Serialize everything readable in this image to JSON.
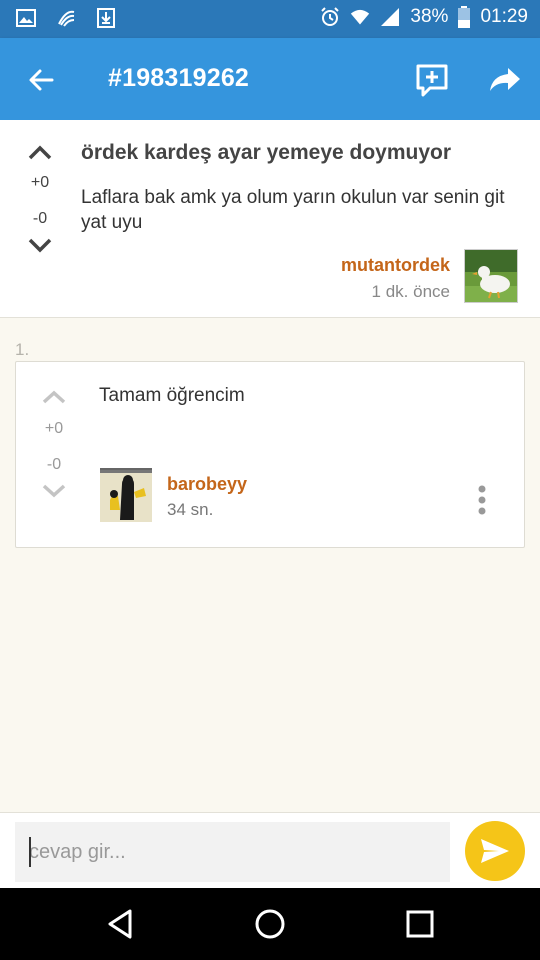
{
  "status_bar": {
    "battery": "38%",
    "time": "01:29",
    "icons": [
      "image-icon",
      "swiftkey-icon",
      "download-icon",
      "alarm-icon",
      "wifi-icon",
      "signal-icon",
      "battery-icon"
    ]
  },
  "app_bar": {
    "title": "#198319262",
    "icons": [
      "back-arrow-icon",
      "add-comment-icon",
      "share-icon"
    ]
  },
  "post": {
    "title": "ördek kardeş ayar yemeye doymuyor",
    "body": "Laflara bak amk ya olum yarın okulun var senin git yat uyu",
    "upvotes": "+0",
    "downvotes": "-0",
    "author": "mutantordek",
    "time": "1 dk. önce"
  },
  "comments": [
    {
      "index": "1.",
      "text": "Tamam öğrencim",
      "upvotes": "+0",
      "downvotes": "-0",
      "author": "barobeyy",
      "time": "34 sn."
    }
  ],
  "reply": {
    "placeholder": "cevap gir..."
  },
  "colors": {
    "app_bar": "#3595dd",
    "status_bar": "#2b78b8",
    "author": "#c4661a",
    "send_button": "#f5c518",
    "background": "#faf8f0"
  }
}
